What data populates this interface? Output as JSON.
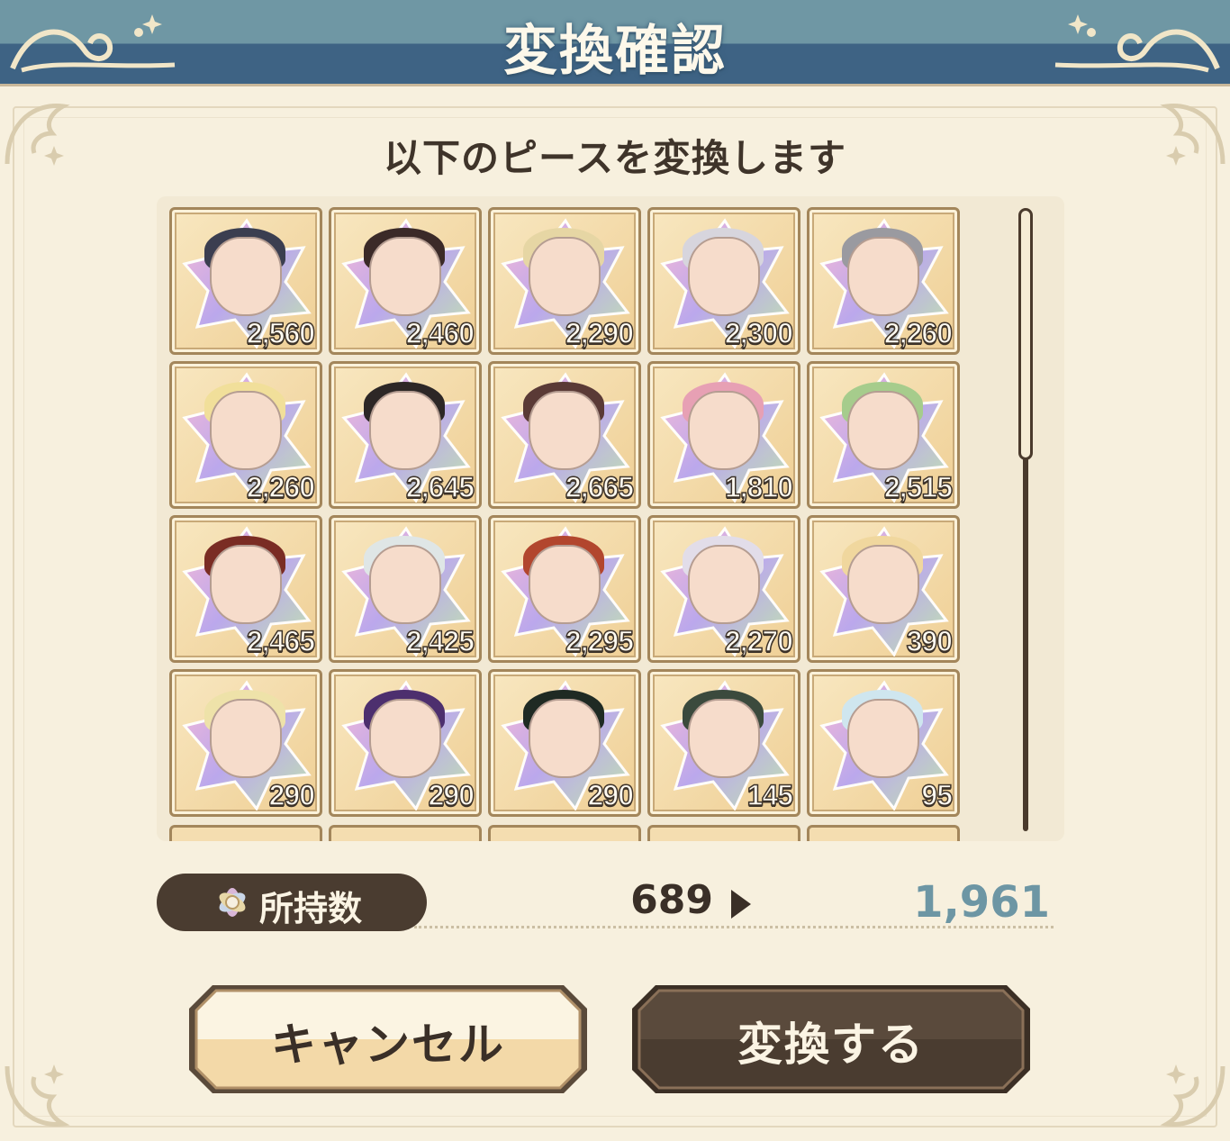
{
  "header": {
    "title": "変換確認"
  },
  "dialog": {
    "subtitle": "以下のピースを変換します"
  },
  "pieces": [
    {
      "count": "2,560",
      "hair": "#3b3e50"
    },
    {
      "count": "2,460",
      "hair": "#3b2a28"
    },
    {
      "count": "2,290",
      "hair": "#e6d6a4"
    },
    {
      "count": "2,300",
      "hair": "#d7d5dd"
    },
    {
      "count": "2,260",
      "hair": "#9a9aa0"
    },
    {
      "count": "2,260",
      "hair": "#f1df9a"
    },
    {
      "count": "2,645",
      "hair": "#2d2726"
    },
    {
      "count": "2,665",
      "hair": "#5a3a36"
    },
    {
      "count": "1,810",
      "hair": "#e7a0b4"
    },
    {
      "count": "2,515",
      "hair": "#a6cc8c"
    },
    {
      "count": "2,465",
      "hair": "#7a2c24"
    },
    {
      "count": "2,425",
      "hair": "#dfe6e6"
    },
    {
      "count": "2,295",
      "hair": "#b2462e"
    },
    {
      "count": "2,270",
      "hair": "#e2dde9"
    },
    {
      "count": "390",
      "hair": "#f0d79e"
    },
    {
      "count": "290",
      "hair": "#eee2a9"
    },
    {
      "count": "290",
      "hair": "#4d2f6e"
    },
    {
      "count": "290",
      "hair": "#1f2a23"
    },
    {
      "count": "145",
      "hair": "#3b4a3d"
    },
    {
      "count": "95",
      "hair": "#cfe6ef"
    }
  ],
  "holdings": {
    "label": "所持数",
    "before": "689",
    "after": "1,961"
  },
  "buttons": {
    "cancel": "キャンセル",
    "confirm": "変換する"
  },
  "colors": {
    "accent_blue": "#6d96a4",
    "dark_brown": "#4a3c30",
    "header_top": "#6f97a4",
    "header_bottom": "#3e6384"
  }
}
